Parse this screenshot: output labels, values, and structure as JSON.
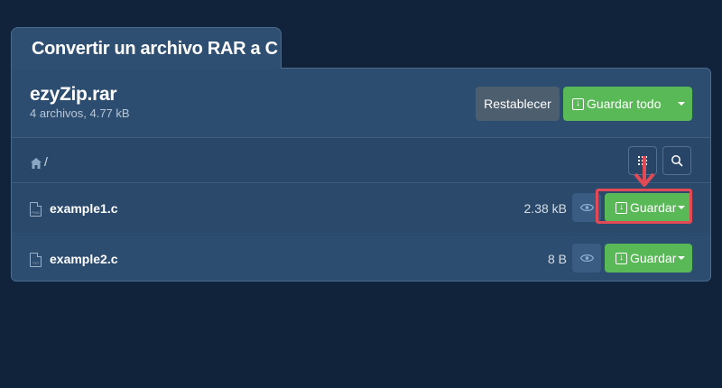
{
  "tab": {
    "title": "Convertir un archivo RAR a C"
  },
  "archive": {
    "name": "ezyZip.rar",
    "meta": "4 archivos, 4.77 kB",
    "reset_label": "Restablecer",
    "save_all_label": "Guardar todo"
  },
  "breadcrumb": {
    "separator": "/"
  },
  "files": [
    {
      "name": "example1.c",
      "size": "2.38 kB",
      "type": "PNG",
      "save_label": "Guardar"
    },
    {
      "name": "example2.c",
      "size": "8 B",
      "type": "TXT",
      "save_label": "Guardar"
    }
  ],
  "colors": {
    "background": "#11233a",
    "panel": "#294869",
    "accent": "#58b956",
    "highlight": "#e24a55"
  }
}
